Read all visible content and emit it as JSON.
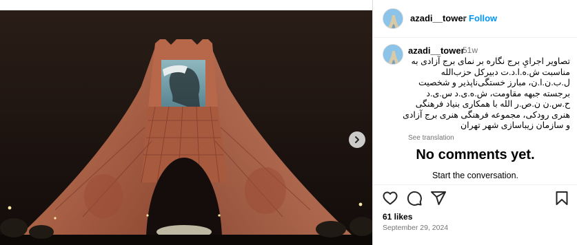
{
  "post": {
    "username": "azadi__tower",
    "follow_label": "Follow",
    "separator": "•",
    "time_ago": "51w",
    "caption": "تصاوير اجرايِ برج نگاره بر نمای برج آزادی به مناسبت ش.ه.ا.د.ت دبیرکل حزب‌الله ل.ب.ن.ا.ن، مبارز خستگی‌ناپذیر و شخصیت برجسته جبهه مقاومت، ش.ه.ی.د س.ی.د ح.س.ن ن.ص.ر الله با همکاری بنیاد فرهنگی هنری رودکی، مجموعه فرهنگی هنری برج آزادی و سازمان زیباسازی شهر تهران",
    "see_translation": "See translation",
    "no_comments_title": "No comments yet.",
    "no_comments_sub": "Start the conversation.",
    "likes": "61 likes",
    "date": "September 29, 2024"
  },
  "icons": {
    "like": "heart-icon",
    "comment": "comment-icon",
    "share": "share-icon",
    "save": "bookmark-icon",
    "next": "chevron-right-icon"
  },
  "colors": {
    "link": "#0095f6",
    "muted": "#737373",
    "tower_light": "#b86a4c",
    "night_sky": "#1c1310"
  }
}
